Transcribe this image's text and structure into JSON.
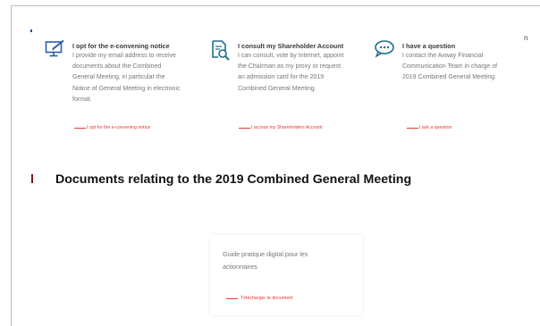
{
  "options": [
    {
      "icon": "monitor-pen-icon",
      "title": "I opt for the e-convening notice",
      "lines": [
        "I provide my email address to receive",
        "documents about the Combined",
        "General Meeting, in particular the",
        "Notice of General Meeting in electronic",
        "format."
      ],
      "cta": "I opt for the e-convening notice"
    },
    {
      "icon": "document-search-icon",
      "title": "I consult my Shareholder Account",
      "lines": [
        "I can consult, vote by Internet, appoint",
        "the Chairman as my proxy or request",
        "an admission card for the 2019",
        "Combined General Meeting."
      ],
      "cta": "I access my Shareholders Account"
    },
    {
      "icon": "chat-bubble-icon",
      "title": "I have a question",
      "lines": [
        "I contact the Axway Financial",
        "Communication Team in charge of",
        "2019 Combined General Meeting."
      ],
      "cta": "I ask a question"
    }
  ],
  "stray_letter": "n",
  "section_heading": "Documents relating to the 2019 Combined General Meeting",
  "document": {
    "title_lines": [
      "Guide pratique digital pour les",
      "actionnaires"
    ],
    "cta": "Télécharger le document"
  },
  "colors": {
    "accent_red": "#e53935",
    "icon_blue": "#2b5ea6",
    "icon_teal": "#1e6e8a"
  }
}
